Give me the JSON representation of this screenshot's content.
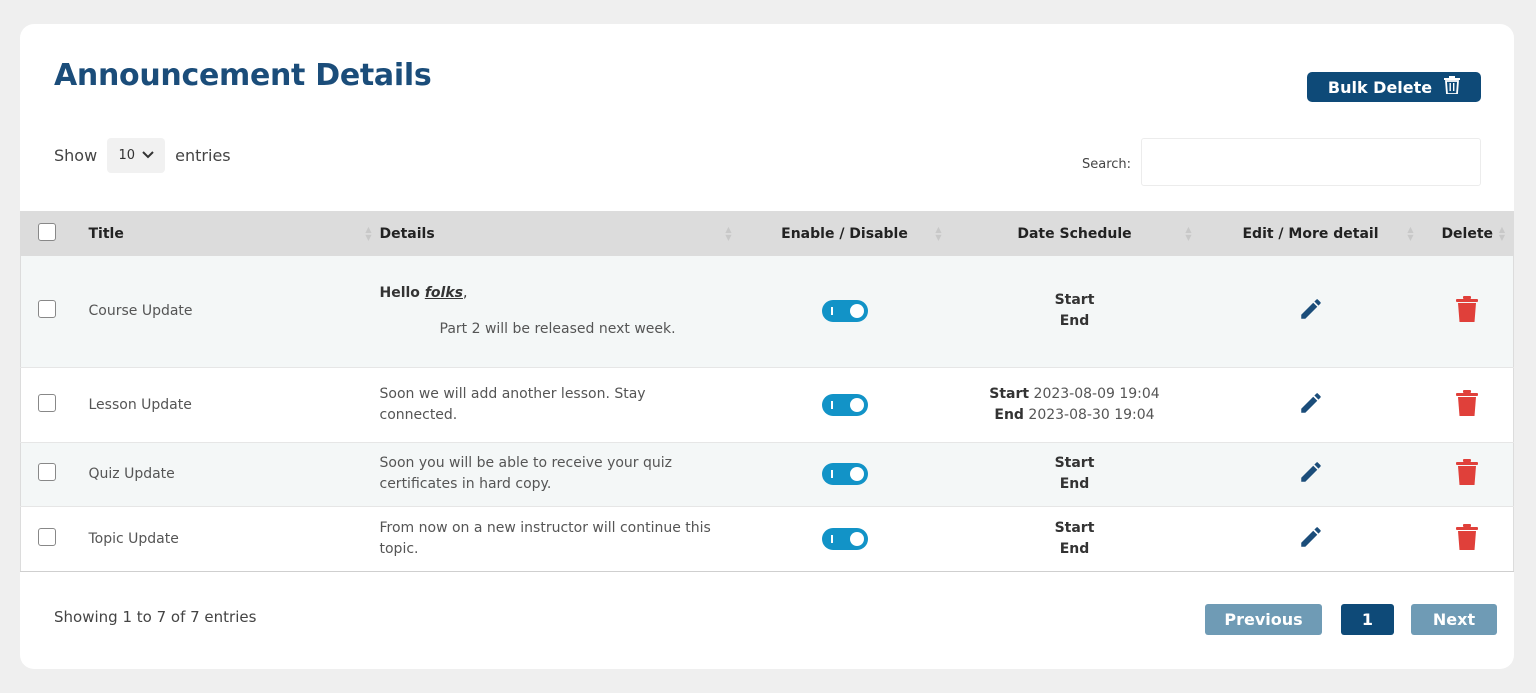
{
  "page": {
    "title": "Announcement Details"
  },
  "toolbar": {
    "bulk_delete_label": "Bulk Delete"
  },
  "length": {
    "show_label": "Show",
    "value": "10",
    "entries_label": "entries"
  },
  "search": {
    "label": "Search:",
    "value": ""
  },
  "table": {
    "headers": [
      "Title",
      "Details",
      "Enable / Disable",
      "Date Schedule",
      "Edit / More detail",
      "Delete"
    ],
    "rows": [
      {
        "title": "Course Update",
        "details_line1_prefix": "Hello ",
        "details_line1_link": "folks",
        "details_line1_suffix": ",",
        "details_line2": "Part 2 will be released next week.",
        "enabled": true,
        "start_label": "Start",
        "start_value": "",
        "end_label": "End",
        "end_value": ""
      },
      {
        "title": "Lesson Update",
        "details": "Soon we will add another lesson. Stay connected.",
        "enabled": true,
        "start_label": "Start",
        "start_value": "2023-08-09 19:04",
        "end_label": "End",
        "end_value": "2023-08-30 19:04"
      },
      {
        "title": "Quiz Update",
        "details": "Soon you will be able to receive your quiz certificates in hard copy.",
        "enabled": true,
        "start_label": "Start",
        "start_value": "",
        "end_label": "End",
        "end_value": ""
      },
      {
        "title": "Topic Update",
        "details": "From now on a new instructor will continue this topic.",
        "enabled": true,
        "start_label": "Start",
        "start_value": "",
        "end_label": "End",
        "end_value": ""
      }
    ]
  },
  "footer": {
    "info": "Showing 1 to 7 of 7 entries"
  },
  "pagination": {
    "previous_label": "Previous",
    "current_page": "1",
    "next_label": "Next"
  },
  "icons": {
    "bulk": "trash-icon",
    "edit": "pencil-icon",
    "delete": "trash-icon",
    "sort": "sort-arrows-icon",
    "select": "chevron-down-icon"
  },
  "colors": {
    "primary": "#0e4a78",
    "toggle": "#1293c7",
    "delete": "#e0403a",
    "edit": "#1b4d7a",
    "pager_disabled": "#6f9bb5"
  }
}
